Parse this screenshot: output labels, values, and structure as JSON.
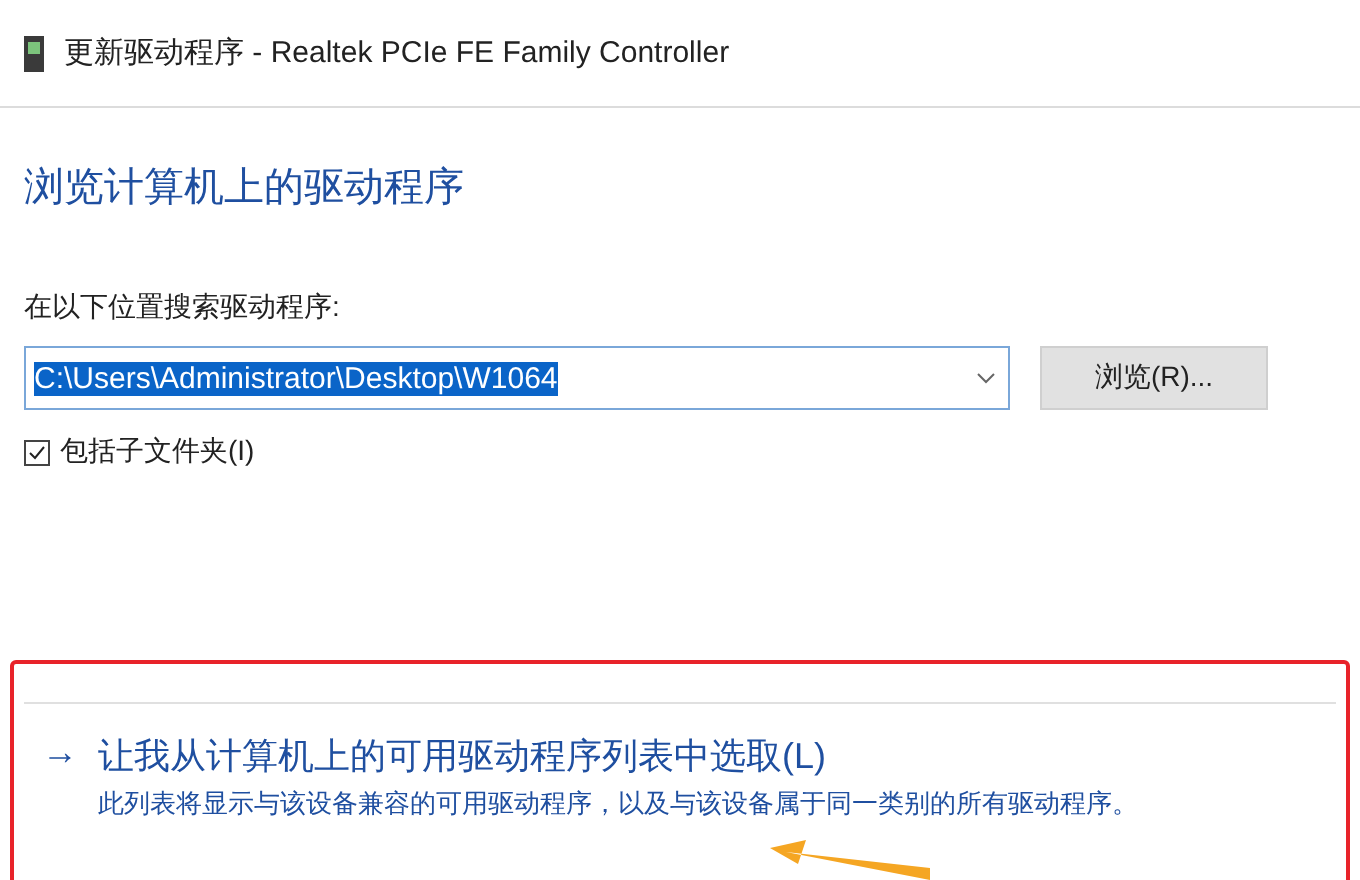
{
  "window": {
    "title": "更新驱动程序 - Realtek PCIe FE Family Controller"
  },
  "heading": "浏览计算机上的驱动程序",
  "search": {
    "label": "在以下位置搜索驱动程序:",
    "value": "C:\\Users\\Administrator\\Desktop\\W1064",
    "selected": true
  },
  "browse_button": "浏览(R)...",
  "include_subfolders": {
    "label": "包括子文件夹(I)",
    "checked": true
  },
  "option": {
    "arrow": "→",
    "title": "让我从计算机上的可用驱动程序列表中选取(L)",
    "description": "此列表将显示与该设备兼容的可用驱动程序，以及与该设备属于同一类别的所有驱动程序。"
  }
}
